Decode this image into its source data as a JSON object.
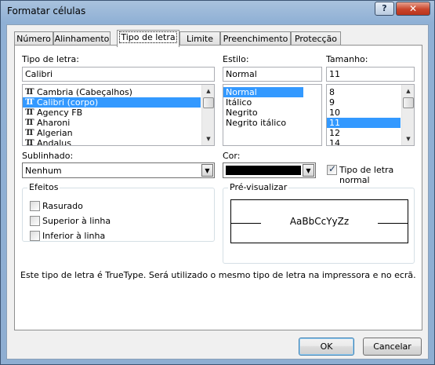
{
  "window": {
    "title": "Formatar células"
  },
  "titlebar": {
    "help_label": "?",
    "close_label": "✕"
  },
  "tabs": [
    {
      "label": "Número"
    },
    {
      "label": "Alinhamento"
    },
    {
      "label": "Tipo de letra"
    },
    {
      "label": "Limite"
    },
    {
      "label": "Preenchimento"
    },
    {
      "label": "Protecção"
    }
  ],
  "active_tab": "Tipo de letra",
  "font": {
    "label": "Tipo de letra:",
    "value": "Calibri",
    "tt_glyph": "TT",
    "items": [
      {
        "label": "Cambria (Cabeçalhos)",
        "selected": false
      },
      {
        "label": "Calibri (corpo)",
        "selected": true
      },
      {
        "label": "Agency FB",
        "selected": false
      },
      {
        "label": "Aharoni",
        "selected": false
      },
      {
        "label": "Algerian",
        "selected": false
      },
      {
        "label": "Andalus",
        "selected": false
      }
    ]
  },
  "style": {
    "label": "Estilo:",
    "value": "Normal",
    "items": [
      {
        "label": "Normal",
        "selected": true
      },
      {
        "label": "Itálico",
        "selected": false
      },
      {
        "label": "Negrito",
        "selected": false
      },
      {
        "label": "Negrito itálico",
        "selected": false
      }
    ]
  },
  "size": {
    "label": "Tamanho:",
    "value": "11",
    "items": [
      {
        "label": "8",
        "selected": false
      },
      {
        "label": "9",
        "selected": false
      },
      {
        "label": "10",
        "selected": false
      },
      {
        "label": "11",
        "selected": true
      },
      {
        "label": "12",
        "selected": false
      },
      {
        "label": "14",
        "selected": false
      }
    ]
  },
  "underline": {
    "label": "Sublinhado:",
    "value": "Nenhum"
  },
  "color": {
    "label": "Cor:",
    "value_hex": "#000000",
    "normal_label": "Tipo de letra normal",
    "normal_checked": true
  },
  "effects": {
    "title": "Efeitos",
    "items": [
      {
        "label": "Rasurado",
        "checked": false
      },
      {
        "label": "Superior à linha",
        "checked": false
      },
      {
        "label": "Inferior à linha",
        "checked": false
      }
    ]
  },
  "preview": {
    "title": "Pré-visualizar",
    "sample": "AaBbCcYyZz"
  },
  "info_text": "Este tipo de letra é TrueType. Será utilizado o mesmo tipo de letra na impressora e no ecrã.",
  "buttons": {
    "ok": "OK",
    "cancel": "Cancelar"
  },
  "icons": {
    "dropdown": "▼",
    "scroll_up": "▲",
    "scroll_down": "▼"
  }
}
